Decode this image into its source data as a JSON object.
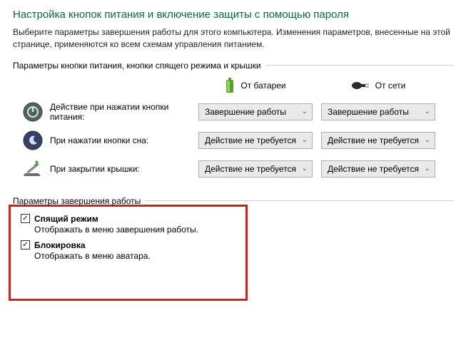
{
  "title": "Настройка кнопок питания и включение защиты с помощью пароля",
  "description": "Выберите параметры завершения работы для этого компьютера. Изменения параметров, внесенные на этой странице, применяются ко всем схемам управления питанием.",
  "group1": {
    "legend": "Параметры кнопки питания, кнопки спящего режима и крышки",
    "col_battery": "От батареи",
    "col_plugged": "От сети",
    "rows": [
      {
        "label": "Действие при нажатии кнопки питания:",
        "battery": "Завершение работы",
        "plugged": "Завершение работы"
      },
      {
        "label": "При нажатии кнопки сна:",
        "battery": "Действие не требуется",
        "plugged": "Действие не требуется"
      },
      {
        "label": "При закрытии крышки:",
        "battery": "Действие не требуется",
        "plugged": "Действие не требуется"
      }
    ]
  },
  "group2": {
    "legend": "Параметры завершения работы",
    "items": [
      {
        "label": "Спящий режим",
        "desc": "Отображать в меню завершения работы."
      },
      {
        "label": "Блокировка",
        "desc": "Отображать в меню аватара."
      }
    ]
  }
}
